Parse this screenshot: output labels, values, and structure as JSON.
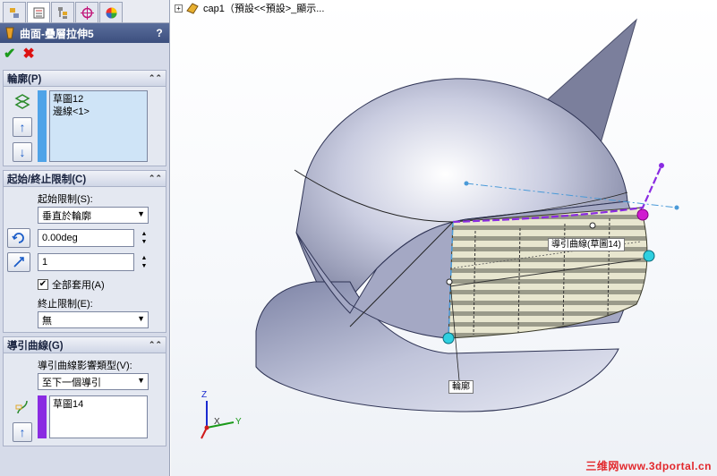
{
  "tabs": [
    {
      "name": "feature-manager-tab",
      "icon": "feature-tree-icon"
    },
    {
      "name": "property-manager-tab",
      "icon": "property-icon"
    },
    {
      "name": "configuration-manager-tab",
      "icon": "configuration-icon"
    },
    {
      "name": "dimxpert-tab",
      "icon": "crosshair-icon"
    },
    {
      "name": "display-manager-tab",
      "icon": "color-wheel-icon"
    }
  ],
  "feature": {
    "title": "曲面-疊層拉伸5",
    "help": "?",
    "ok_icon": "✔",
    "cancel_icon": "✖"
  },
  "profile": {
    "header": "輪廓(P)",
    "items": [
      "草圖12",
      "邊線<1>"
    ],
    "up": "↑",
    "down": "↓"
  },
  "constraints": {
    "header": "起始/終止限制(C)",
    "start_label": "起始限制(S):",
    "start_value": "垂直於輪廓",
    "angle_value": "0.00deg",
    "length_value": "1",
    "apply_all_label": "全部套用(A)",
    "apply_all_checked": true,
    "end_label": "終止限制(E):",
    "end_value": "無"
  },
  "guides": {
    "header": "導引曲線(G)",
    "influence_label": "導引曲線影響類型(V):",
    "influence_value": "至下一個導引",
    "items": [
      "草圖14"
    ],
    "up": "↑"
  },
  "graphics": {
    "tree_text": "cap1（預設<<預設>_顯示...",
    "callout_guide": "導引曲線(草圖14)",
    "callout_profile": "輪廓",
    "axis_x": "X",
    "axis_y": "Y",
    "axis_z": "Z",
    "watermark": "三维网www.3dportal.cn"
  },
  "colors": {
    "accent": "#3c4f7e",
    "profile_bar": "#4fa3e8",
    "guide_bar": "#8a2be2",
    "surface": "#b8bcd6",
    "guide_curve": "#8a2be2"
  }
}
